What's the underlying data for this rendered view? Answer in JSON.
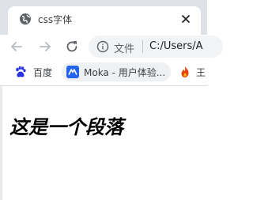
{
  "tab": {
    "title": "css字体",
    "favicon": "globe-icon",
    "close": "close-icon"
  },
  "toolbar": {
    "back": "arrow-left-icon",
    "forward": "arrow-right-icon",
    "reload": "reload-icon",
    "security_icon": "info-icon",
    "scheme_label": "文件",
    "url": "C:/Users/A"
  },
  "bookmarks": [
    {
      "label": "百度",
      "icon": "baidu-paw-icon",
      "color": "#2932e1"
    },
    {
      "label": "Moka - 用户体验...",
      "icon": "moka-icon",
      "color": "#2563eb"
    },
    {
      "label": "王",
      "icon": "flame-icon",
      "color": "#e8430b"
    }
  ],
  "page": {
    "paragraph": "这是一个段落"
  },
  "colors": {
    "titlebar": "#dee1e6",
    "tab": "#ffffff",
    "omnibox": "#f1f3f4",
    "text": "#000000"
  }
}
